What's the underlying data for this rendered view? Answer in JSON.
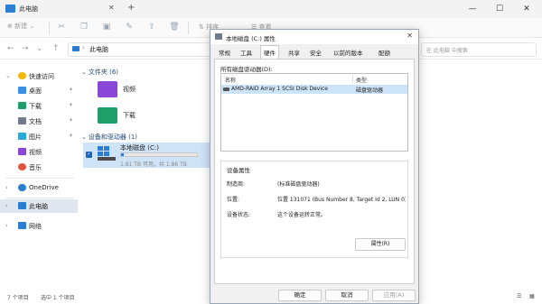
{
  "explorer": {
    "tab_title": "此电脑",
    "window_controls": [
      "—",
      "☐",
      "✕"
    ],
    "toolbar": {
      "new_label": "新建",
      "sort_label": "排序",
      "view_label": "查看"
    },
    "address": {
      "crumb": "此电脑",
      "search_placeholder": "在 此电脑 中搜索"
    },
    "sidebar": {
      "items": [
        {
          "label": "快速访问",
          "chevron": "⌄",
          "icon": "star-icon",
          "color": "#f5b800"
        },
        {
          "label": "桌面",
          "icon": "desktop-icon",
          "color": "#3a8ee6",
          "pinned": true
        },
        {
          "label": "下载",
          "icon": "download-icon",
          "color": "#1f9e6a",
          "pinned": true
        },
        {
          "label": "文档",
          "icon": "document-icon",
          "color": "#6f7b8a",
          "pinned": true
        },
        {
          "label": "图片",
          "icon": "picture-icon",
          "color": "#2aa8d8",
          "pinned": true
        },
        {
          "label": "视频",
          "icon": "video-icon",
          "color": "#8a46d6"
        },
        {
          "label": "音乐",
          "icon": "music-icon",
          "color": "#e2543f"
        },
        {
          "label": "OneDrive",
          "chevron": "›",
          "icon": "cloud-icon",
          "color": "#2a7fd5"
        },
        {
          "label": "此电脑",
          "chevron": "›",
          "icon": "computer-icon",
          "color": "#2b7cd3",
          "selected": true
        },
        {
          "label": "网络",
          "chevron": "›",
          "icon": "network-icon",
          "color": "#2b7cd3"
        }
      ]
    },
    "content": {
      "folders_header": "文件夹 (6)",
      "folders": [
        {
          "label": "视频",
          "icon": "video-folder-icon",
          "color": "#8a46d6"
        },
        {
          "label": "下载",
          "icon": "download-folder-icon",
          "color": "#1f9e6a"
        }
      ],
      "drives_header": "设备和驱动器 (1)",
      "drive": {
        "name": "本地磁盘 (C:)",
        "free_text": "1.81 TB 可用，共 1.86 TB",
        "used_fraction": 0.03
      }
    },
    "status": {
      "items": "7 个项目",
      "selected": "选中 1 个项目"
    }
  },
  "dialog": {
    "title": "本地磁盘 (C:) 属性",
    "tabs": [
      "常规",
      "工具",
      "硬件",
      "共享",
      "安全",
      "以前的版本",
      "配额"
    ],
    "active_tab": "硬件",
    "all_drives_label": "所有磁盘驱动器(D):",
    "list": {
      "col_name": "名称",
      "col_type": "类型",
      "rows": [
        {
          "name": "AMD-RAID Array 1  SCSI Disk Device",
          "type": "磁盘驱动器"
        }
      ]
    },
    "device_props": {
      "group_label": "设备属性",
      "manufacturer_key": "制造商:",
      "manufacturer_val": "(标准磁盘驱动器)",
      "location_key": "位置:",
      "location_val": "位置 131071 (Bus Number 8, Target Id 2, LUN 0)",
      "status_key": "设备状态:",
      "status_val": "这个设备运转正常。",
      "properties_button": "属性(R)"
    },
    "buttons": {
      "ok": "确定",
      "cancel": "取消",
      "apply": "应用(A)"
    }
  }
}
